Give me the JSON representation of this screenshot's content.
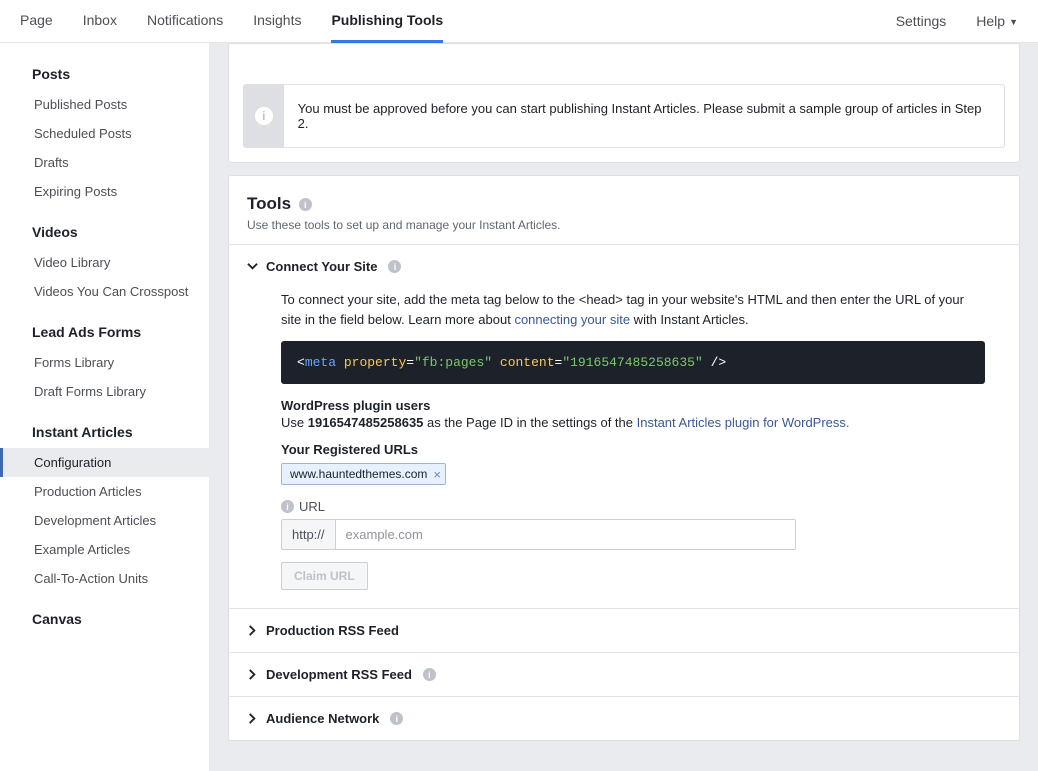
{
  "topnav": {
    "left": [
      {
        "label": "Page"
      },
      {
        "label": "Inbox"
      },
      {
        "label": "Notifications"
      },
      {
        "label": "Insights"
      },
      {
        "label": "Publishing Tools",
        "active": true
      }
    ],
    "right": {
      "settings": "Settings",
      "help": "Help"
    }
  },
  "sidebar": {
    "sections": [
      {
        "title": "Posts",
        "items": [
          "Published Posts",
          "Scheduled Posts",
          "Drafts",
          "Expiring Posts"
        ]
      },
      {
        "title": "Videos",
        "items": [
          "Video Library",
          "Videos You Can Crosspost"
        ]
      },
      {
        "title": "Lead Ads Forms",
        "items": [
          "Forms Library",
          "Draft Forms Library"
        ]
      },
      {
        "title": "Instant Articles",
        "items": [
          "Configuration",
          "Production Articles",
          "Development Articles",
          "Example Articles",
          "Call-To-Action Units"
        ],
        "activeIndex": 0
      },
      {
        "title": "Canvas",
        "items": []
      }
    ]
  },
  "alert": {
    "text": "You must be approved before you can start publishing Instant Articles. Please submit a sample group of articles in Step 2."
  },
  "tools": {
    "title": "Tools",
    "subtitle": "Use these tools to set up and manage your Instant Articles."
  },
  "connect": {
    "header": "Connect Your Site",
    "desc1": "To connect your site, add the meta tag below to the <head> tag in your website's HTML and then enter the URL of your site in the field below. Learn more about ",
    "linkText": "connecting your site",
    "desc2": " with Instant Articles.",
    "meta": {
      "tag": "meta",
      "prop": "property",
      "propVal": "\"fb:pages\"",
      "content": "content",
      "contentVal": "\"1916547485258635\""
    },
    "wp_title": "WordPress plugin users",
    "wp_pre": "Use ",
    "wp_id": "1916547485258635",
    "wp_mid": " as the Page ID in the settings of the ",
    "wp_link": "Instant Articles plugin for WordPress.",
    "registered_title": "Your Registered URLs",
    "registered_url": "www.hauntedthemes.com",
    "url_label": "URL",
    "url_prefix": "http://",
    "url_placeholder": "example.com",
    "claim_btn": "Claim URL"
  },
  "accordions": {
    "prod": "Production RSS Feed",
    "dev": "Development RSS Feed",
    "audience": "Audience Network"
  }
}
